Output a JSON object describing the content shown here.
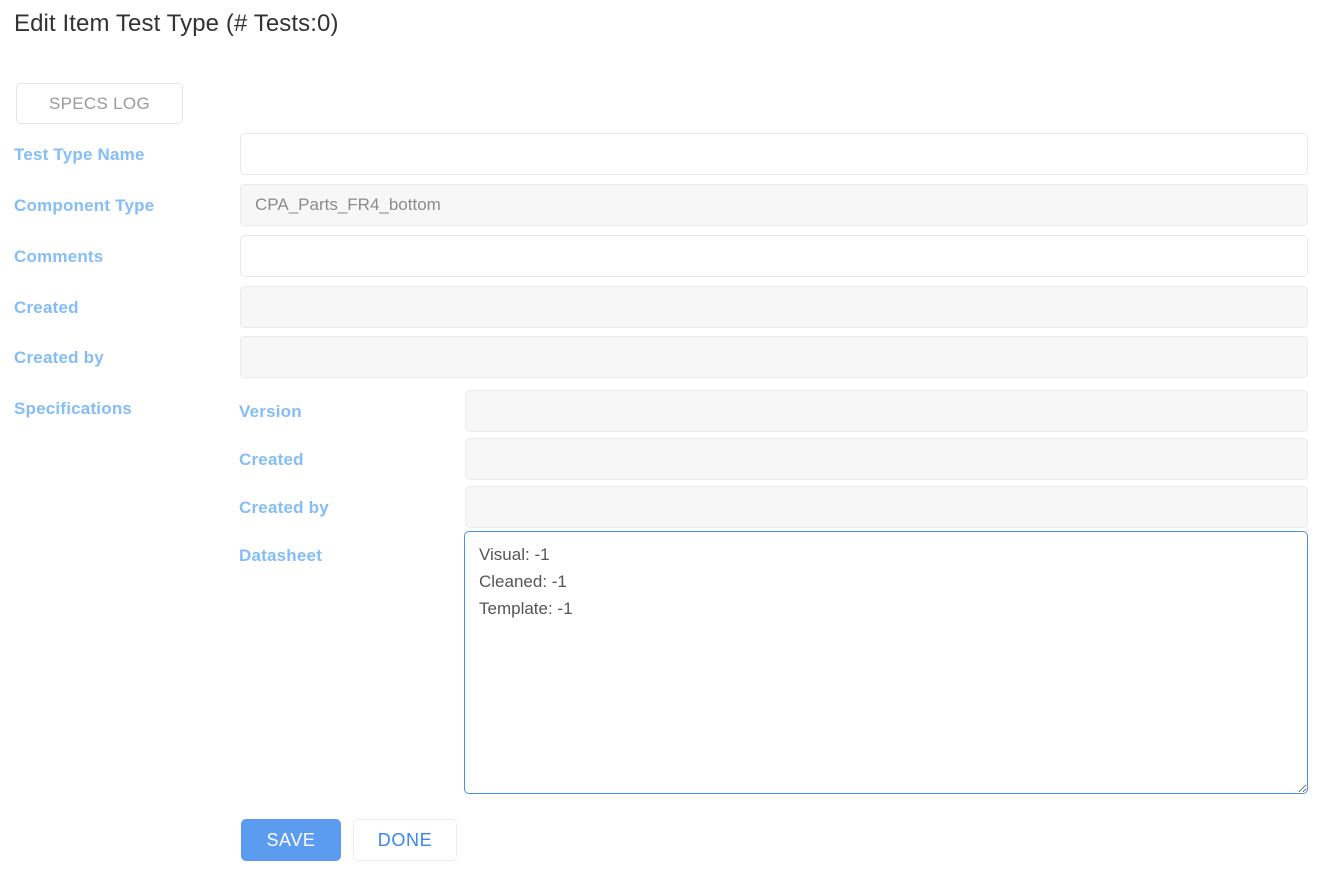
{
  "header": {
    "title": "Edit Item Test Type (# Tests:0)"
  },
  "toolbar": {
    "specs_log_label": "SPECS LOG"
  },
  "form": {
    "fields": [
      {
        "label": "Test Type Name",
        "value": "",
        "placeholder": "",
        "disabled": false
      },
      {
        "label": "Component Type",
        "value": "CPA_Parts_FR4_bottom",
        "placeholder": "",
        "disabled": true
      },
      {
        "label": "Comments",
        "value": "",
        "placeholder": "",
        "disabled": false
      },
      {
        "label": "Created",
        "value": "",
        "placeholder": "",
        "disabled": true
      },
      {
        "label": "Created by",
        "value": "",
        "placeholder": "",
        "disabled": true
      }
    ]
  },
  "specifications": {
    "section_label": "Specifications",
    "fields": [
      {
        "label": "Version",
        "value": "",
        "disabled": true
      },
      {
        "label": "Created",
        "value": "",
        "disabled": true
      },
      {
        "label": "Created by",
        "value": "",
        "disabled": true
      }
    ],
    "datasheet": {
      "label": "Datasheet",
      "value": "Visual: -1\nCleaned: -1\nTemplate: -1",
      "focused": true
    }
  },
  "actions": {
    "save_label": "SAVE",
    "done_label": "DONE"
  },
  "colors": {
    "label_blue": "#85bdf7",
    "primary_blue": "#5b9bf0",
    "link_blue": "#3a86f0",
    "focus_border": "#4a90e2",
    "title_text": "#333333",
    "muted_text": "#8b8b8b",
    "disabled_bg": "#f7f7f7"
  }
}
